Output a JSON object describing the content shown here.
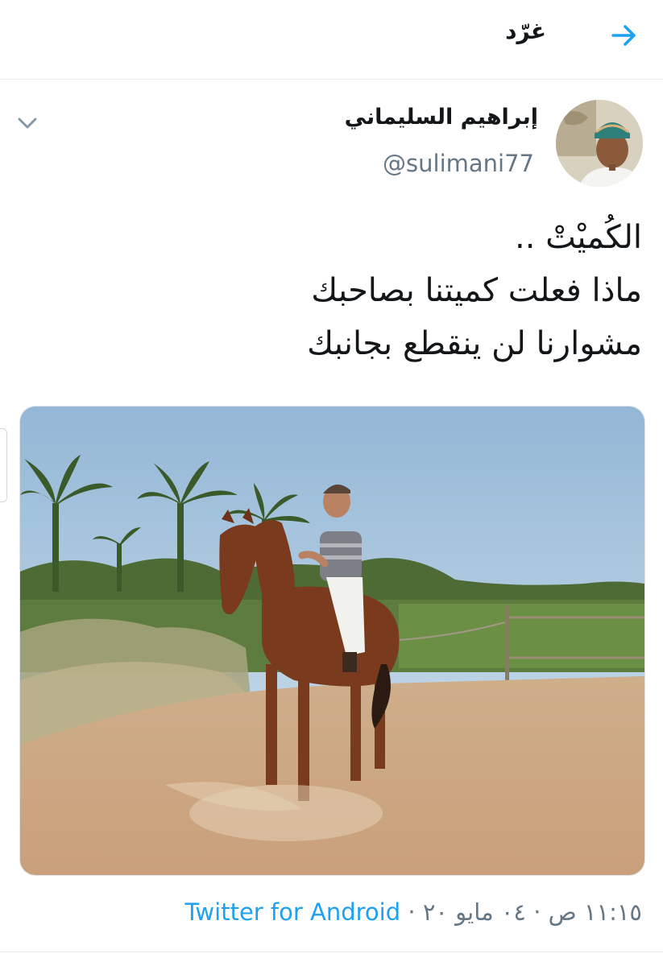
{
  "header": {
    "title": "غرّد",
    "back_icon": "arrow-right-icon",
    "accent": "#1da1f2"
  },
  "tweet": {
    "author_name": "إبراهيم السليماني",
    "handle": "@sulimani77",
    "avatar": "avatar-photo",
    "menu_icon": "chevron-down-icon",
    "text_lines": [
      "الكُميْتْ ..",
      "ماذا فعلت كميتنا بصاحبك",
      "مشوارنا لن ينقطع بجانبك"
    ],
    "media": "photo-man-riding-horse",
    "timestamp": "١١:١٥ ص · ٠٤ مايو ٢٠",
    "separator": " · ",
    "source": "Twitter for Android"
  }
}
